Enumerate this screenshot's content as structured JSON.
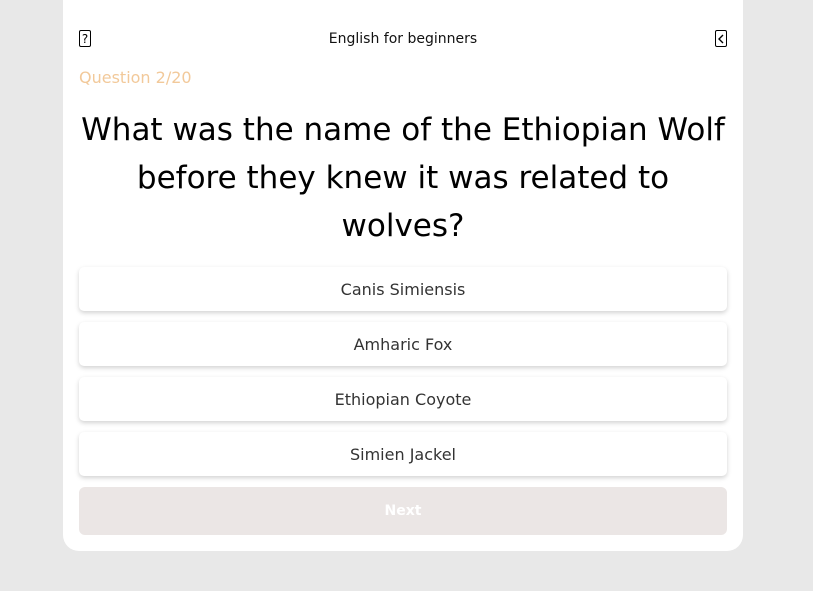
{
  "header": {
    "title": "English for beginners",
    "help_icon": "question-mark-icon",
    "back_icon": "chevron-left-icon",
    "help_label": "?"
  },
  "quiz": {
    "counter": "Question 2/20",
    "question": "What was the name of the Ethiopian Wolf before they knew it was related to wolves?",
    "answers": [
      "Canis Simiensis",
      "Amharic Fox",
      "Ethiopian Coyote",
      "Simien Jackel"
    ],
    "next_label": "Next"
  },
  "colors": {
    "background": "#e8e8e8",
    "card": "#ffffff",
    "counter": "#f2c99a",
    "next_button": "#ebe6e5"
  }
}
